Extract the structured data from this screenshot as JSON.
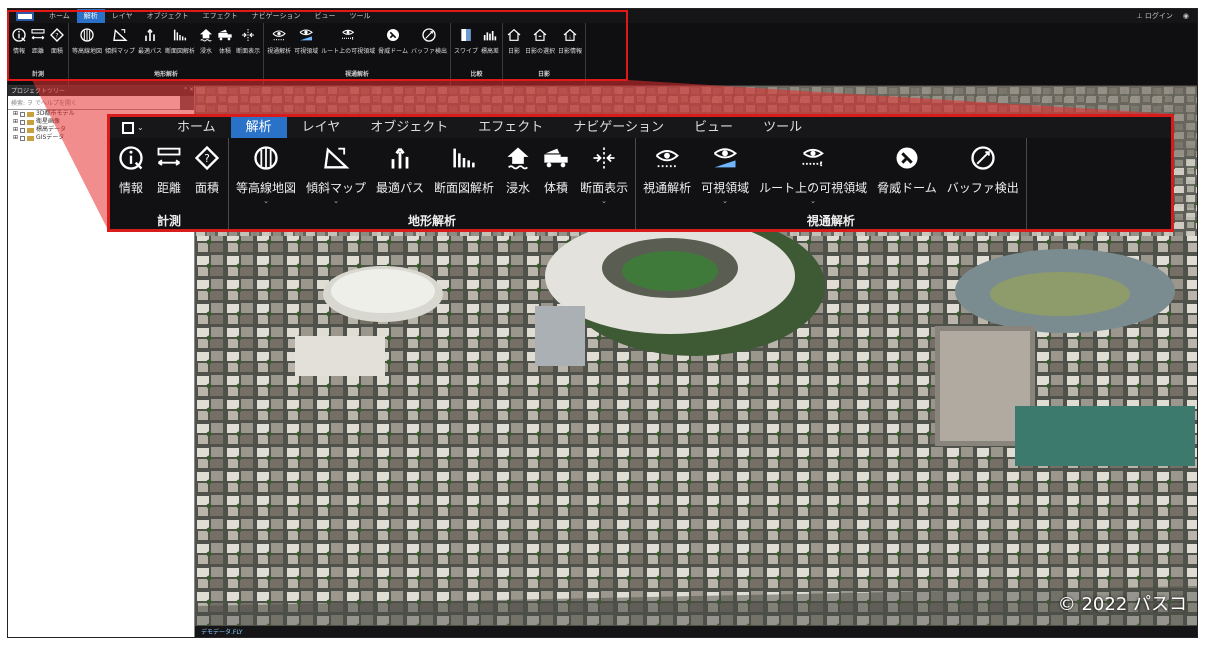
{
  "menubar": {
    "tabs": [
      "ホーム",
      "解析",
      "レイヤ",
      "オブジェクト",
      "エフェクト",
      "ナビゲーション",
      "ビュー",
      "ツール"
    ],
    "active": "解析",
    "login": "ログイン"
  },
  "ribbon": {
    "groups": [
      {
        "label": "計測",
        "items": [
          "情報",
          "距離",
          "面積"
        ]
      },
      {
        "label": "地形解析",
        "items": [
          "等高線地図",
          "傾斜マップ",
          "最適パス",
          "断面図解析",
          "浸水",
          "体積",
          "断面表示"
        ]
      },
      {
        "label": "視通解析",
        "items": [
          "視通解析",
          "可視領域",
          "ルート上の可視領域",
          "脅威ドーム",
          "バッファ検出"
        ]
      },
      {
        "label": "比較",
        "items": [
          "スワイプ",
          "標高差"
        ]
      },
      {
        "label": "日影",
        "items": [
          "日影",
          "日影の選択",
          "日影情報"
        ]
      }
    ]
  },
  "sidebar": {
    "title": "プロジェクトツリー",
    "pin": "ᵖ ×",
    "search_placeholder": "検索: ヲ でヘルプを開く",
    "tree": [
      "3D都市モデル",
      "衛星画像",
      "標高データ",
      "GISデータ"
    ]
  },
  "map": {
    "copyright": "© 2022 パスコ"
  },
  "status": {
    "text": "デモデータ.FLY"
  },
  "colors": {
    "accent": "#2a72c8",
    "highlight": "#d81c1c"
  }
}
